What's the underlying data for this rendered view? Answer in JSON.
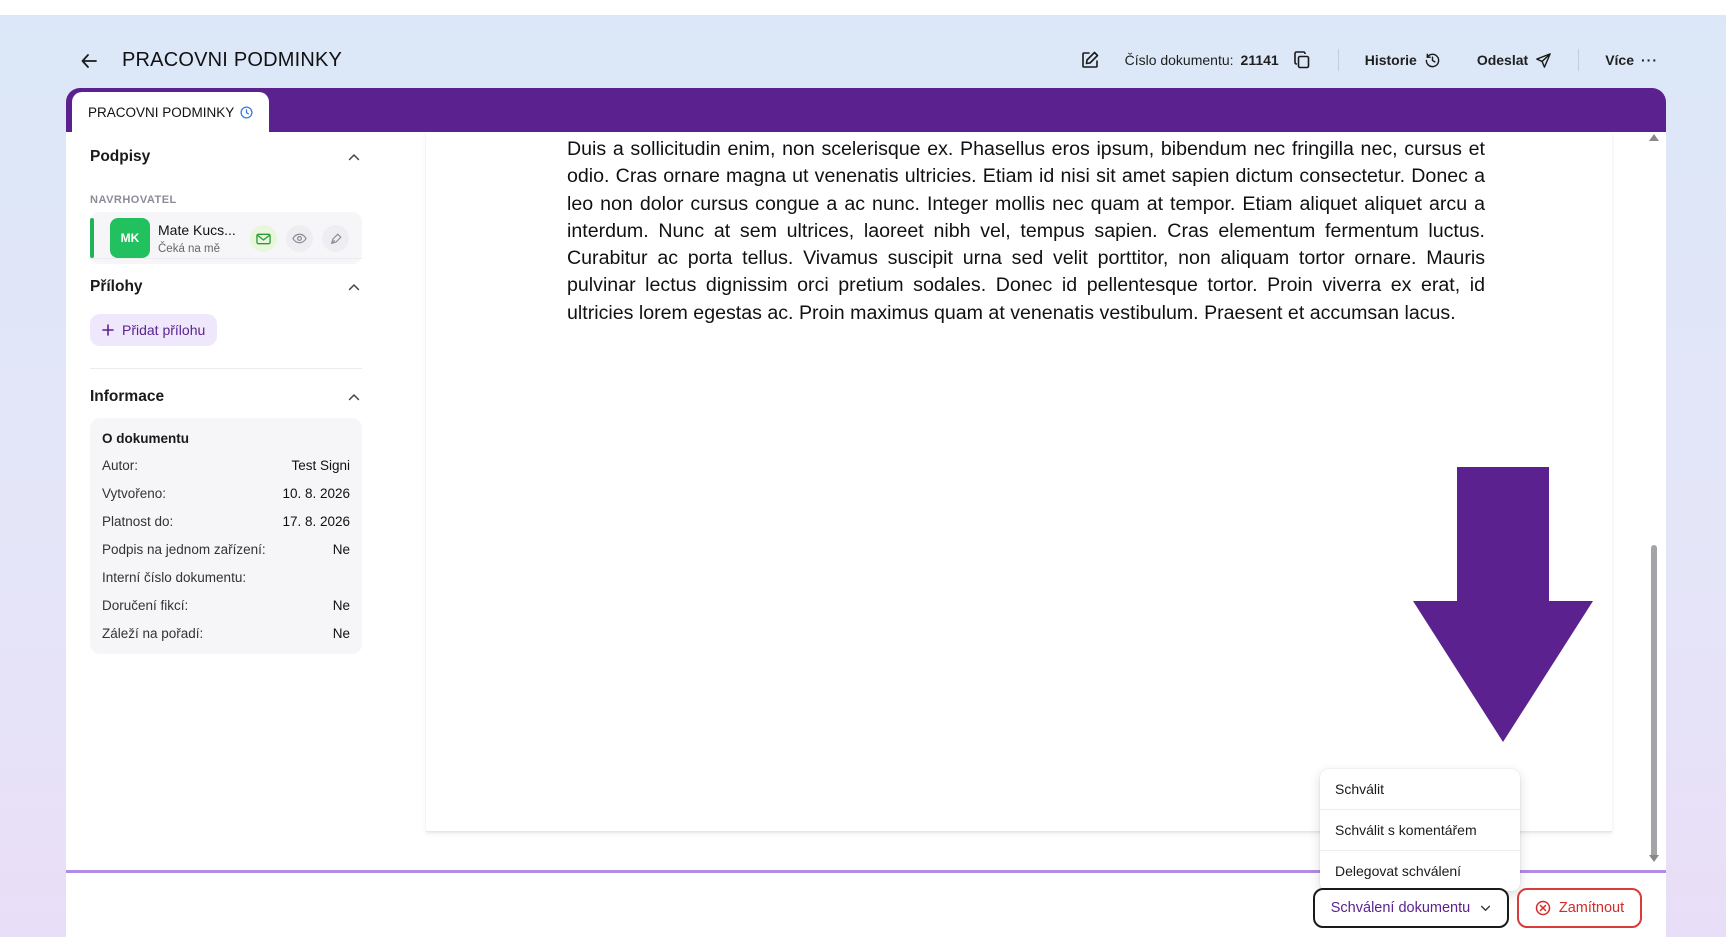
{
  "header": {
    "title": "PRACOVNI PODMINKY",
    "doc_number_label": "Číslo dokumentu:",
    "doc_number": "21141",
    "history_label": "Historie",
    "send_label": "Odeslat",
    "more_label": "Více"
  },
  "tab": {
    "label": "PRACOVNI PODMINKY"
  },
  "sidebar": {
    "signatures": {
      "title": "Podpisy",
      "role": "NAVRHOVATEL",
      "signer": {
        "initials": "MK",
        "name": "Mate Kucs...",
        "status": "Čeká na mě"
      }
    },
    "attachments": {
      "title": "Přílohy",
      "add_label": "Přidat přílohu"
    },
    "info": {
      "title": "Informace",
      "card_title": "O dokumentu",
      "rows": [
        {
          "label": "Autor:",
          "value": "Test Signi"
        },
        {
          "label": "Vytvořeno:",
          "value": "10. 8. 2026"
        },
        {
          "label": "Platnost do:",
          "value": "17. 8. 2026"
        },
        {
          "label": "Podpis na jednom zařízení:",
          "value": "Ne"
        },
        {
          "label": "Interní číslo dokumentu:",
          "value": ""
        },
        {
          "label": "Doručení fikcí:",
          "value": "Ne"
        },
        {
          "label": "Záleží na pořadí:",
          "value": "Ne"
        }
      ]
    }
  },
  "document": {
    "text": "Duis a sollicitudin enim, non scelerisque ex. Phasellus eros ipsum, bibendum nec fringilla nec, cursus et odio. Cras ornare magna ut venenatis ultricies. Etiam id nisi sit amet sapien dictum consectetur. Donec a leo non dolor cursus congue a ac nunc. Integer mollis nec quam at tempor. Etiam aliquet aliquet arcu a interdum. Nunc at sem ultrices, laoreet nibh vel, tempus sapien. Cras elementum fermentum luctus. Curabitur ac porta tellus. Vivamus suscipit urna sed velit porttitor, non aliquam tortor ornare. Mauris pulvinar lectus dignissim orci pretium sodales. Donec id pellentesque tortor. Proin viverra ex erat, id ultricies lorem egestas ac. Proin maximus quam at venenatis vestibulum. Praesent et accumsan lacus."
  },
  "approval_menu": {
    "items": [
      "Schválit",
      "Schválit s komentářem",
      "Delegovat schválení"
    ]
  },
  "footer": {
    "approve_label": "Schválení dokumentu",
    "reject_label": "Zamítnout"
  },
  "colors": {
    "brand": "#5b228f",
    "success": "#21c15f",
    "danger": "#d93a3a"
  }
}
